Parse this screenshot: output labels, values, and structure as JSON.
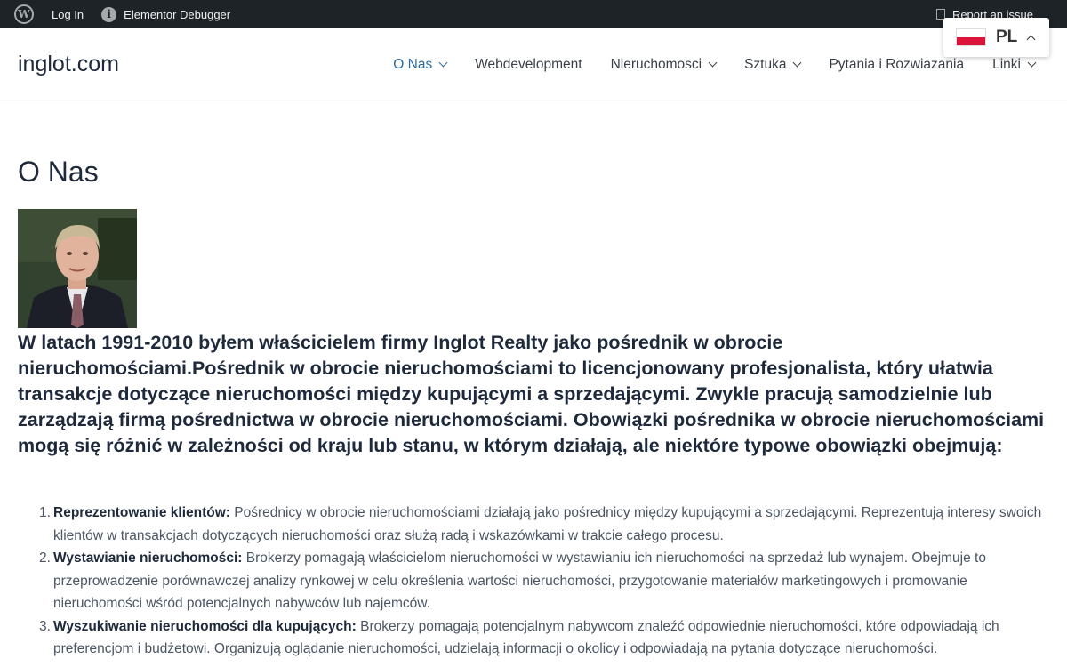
{
  "adminbar": {
    "login_label": "Log In",
    "debugger_label": "Elementor Debugger",
    "report_label": "Report an issue"
  },
  "header": {
    "site_title": "inglot.com",
    "nav": [
      {
        "label": "O Nas",
        "has_dropdown": true,
        "active": true
      },
      {
        "label": "Webdevelopment",
        "has_dropdown": false,
        "active": false
      },
      {
        "label": "Nieruchomosci",
        "has_dropdown": true,
        "active": false
      },
      {
        "label": "Sztuka",
        "has_dropdown": true,
        "active": false
      },
      {
        "label": "Pytania i Rozwiazania",
        "has_dropdown": false,
        "active": false
      },
      {
        "label": "Linki",
        "has_dropdown": true,
        "active": false
      }
    ]
  },
  "language": {
    "code": "PL"
  },
  "content": {
    "title": "O Nas",
    "intro": "W latach 1991-2010 byłem właścicielem firmy Inglot Realty jako pośrednik w obrocie nieruchomościami.Pośrednik w obrocie nieruchomościami to licencjonowany profesjonalista, który ułatwia transakcje dotyczące nieruchomości między kupującymi a sprzedającymi. Zwykle pracują samodzielnie lub zarządzają firmą pośrednictwa w obrocie nieruchomościami. Obowiązki pośrednika w obrocie nieruchomościami mogą się różnić w zależności od kraju lub stanu, w którym działają, ale niektóre typowe obowiązki obejmują:",
    "list": [
      {
        "num": "1.",
        "heading": "Reprezentowanie klientów:",
        "text": " Pośrednicy w obrocie nieruchomościami działają jako pośrednicy między kupującymi a sprzedającymi. Reprezentują interesy swoich klientów w transakcjach dotyczących nieruchomości oraz służą radą i wskazówkami w trakcie całego procesu."
      },
      {
        "num": "2.",
        "heading": "Wystawianie nieruchomości:",
        "text": " Brokerzy pomagają właścicielom nieruchomości w wystawianiu ich nieruchomości na sprzedaż lub wynajem. Obejmuje to przeprowadzenie porównawczej analizy rynkowej w celu określenia wartości nieruchomości, przygotowanie materiałów marketingowych i promowanie nieruchomości wśród potencjalnych nabywców lub najemców."
      },
      {
        "num": "3.",
        "heading": "Wyszukiwanie nieruchomości dla kupujących:",
        "text": " Brokerzy pomagają potencjalnym nabywcom znaleźć odpowiednie nieruchomości, które odpowiadają ich preferencjom i budżetowi. Organizują oglądanie nieruchomości, udzielają informacji o okolicy i odpowiadają na pytania dotyczące nieruchomości."
      }
    ]
  },
  "colors": {
    "adminbar": "#1d2327",
    "nav_active": "#2d6a9f",
    "text": "#1e293b",
    "body_text": "#4b5563"
  }
}
